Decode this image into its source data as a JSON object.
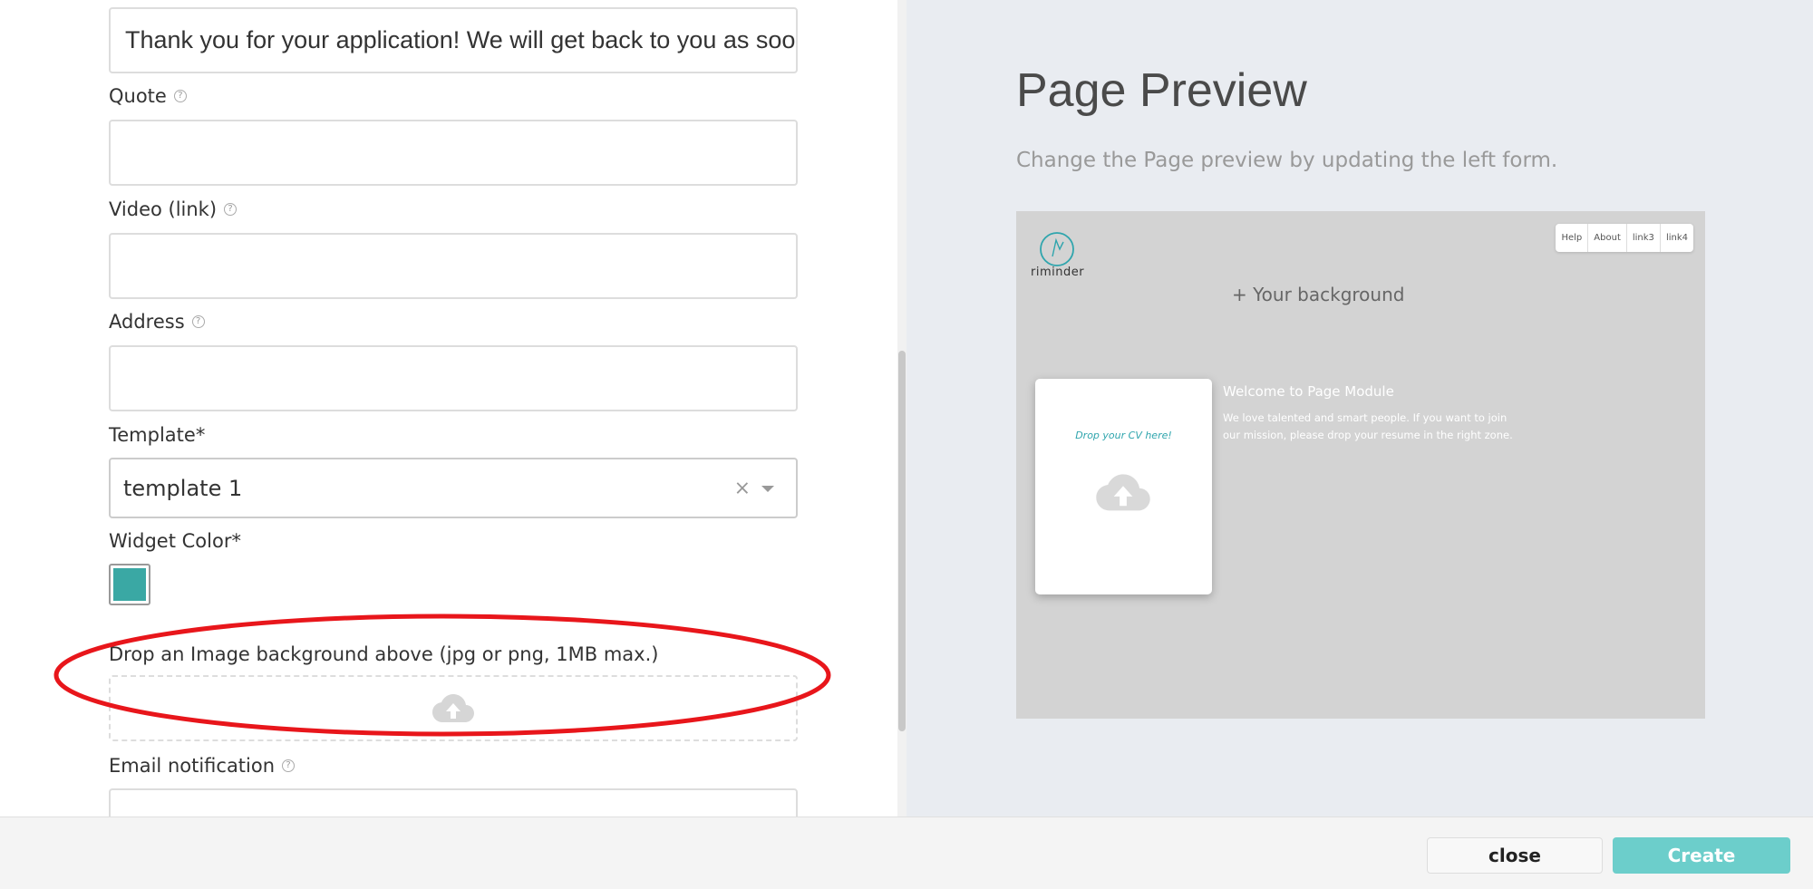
{
  "form": {
    "message_value": "Thank you for your application! We will get back to you as soon",
    "quote_label": "Quote",
    "video_label": "Video (link)",
    "address_label": "Address",
    "template_label": "Template*",
    "template_value": "template 1",
    "template_clear": "×",
    "widget_color_label": "Widget Color*",
    "widget_color": "#3aa8a4",
    "dropzone_label": "Drop an Image background above (jpg or png, 1MB max.)",
    "email_label": "Email notification",
    "help_glyph": "?"
  },
  "preview": {
    "title": "Page Preview",
    "subtitle": "Change the Page preview by updating the left form.",
    "logo_text": "riminder",
    "nav_links": [
      "Help",
      "About",
      "link3",
      "link4"
    ],
    "background_label": "+ Your background",
    "cv_card_text": "Drop your CV here!",
    "welcome_title": "Welcome to Page Module",
    "welcome_text": "We love talented and smart people. If you want to join our mission, please drop your resume in the right zone."
  },
  "footer": {
    "close_label": "close",
    "create_label": "Create"
  },
  "colors": {
    "accent": "#6ccecb",
    "widget": "#3aa8a4",
    "highlight": "#e8161b"
  }
}
